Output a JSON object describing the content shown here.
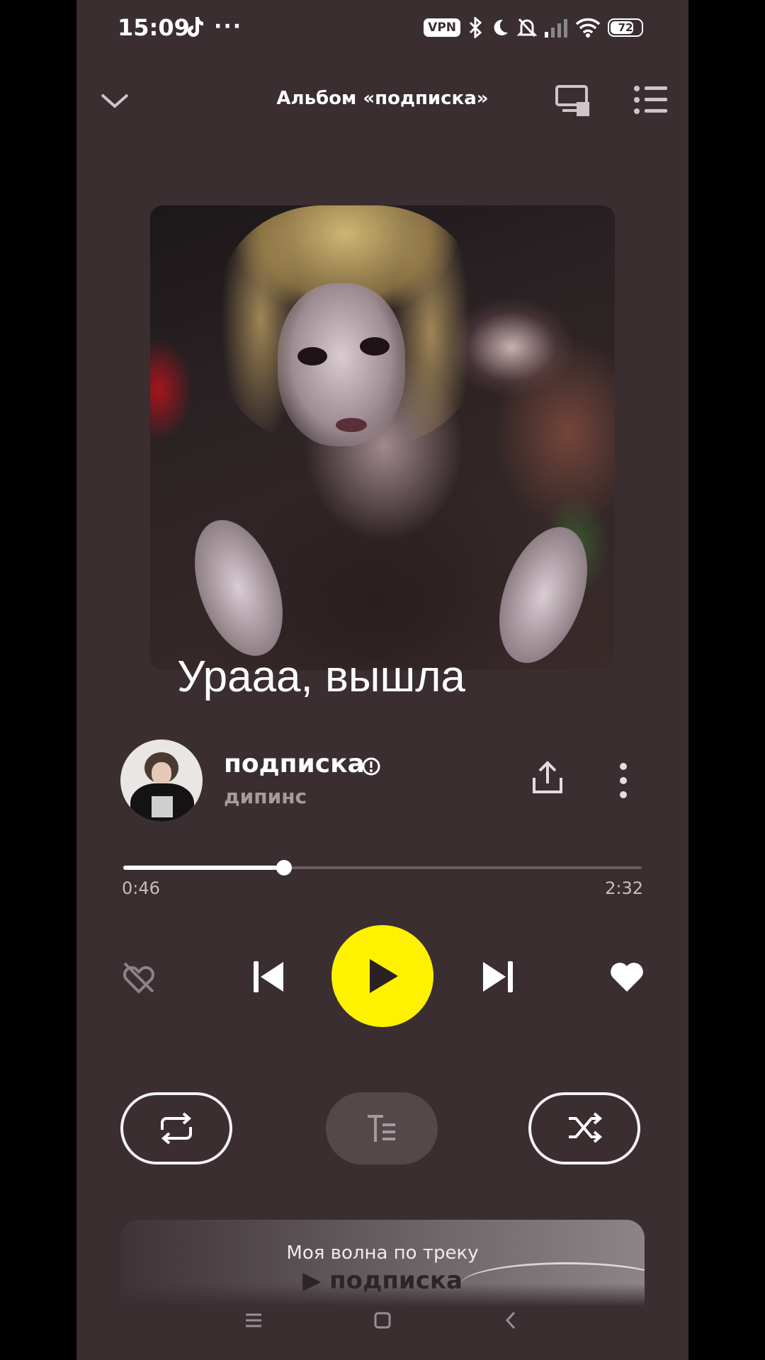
{
  "status_bar": {
    "time": "15:09",
    "dots": "···",
    "vpn": "VPN",
    "battery": "72"
  },
  "header": {
    "title": "Альбом «подписка»"
  },
  "overlay_caption": "Урааа, вышла",
  "track": {
    "title": "подписка",
    "artist": "дипинс"
  },
  "progress": {
    "current": "0:46",
    "total": "2:32",
    "fraction": 0.31
  },
  "wave": {
    "title": "Моя волна по треку",
    "track": "▶ подписка"
  },
  "colors": {
    "background": "#3a2e31",
    "accent": "#fff200"
  }
}
